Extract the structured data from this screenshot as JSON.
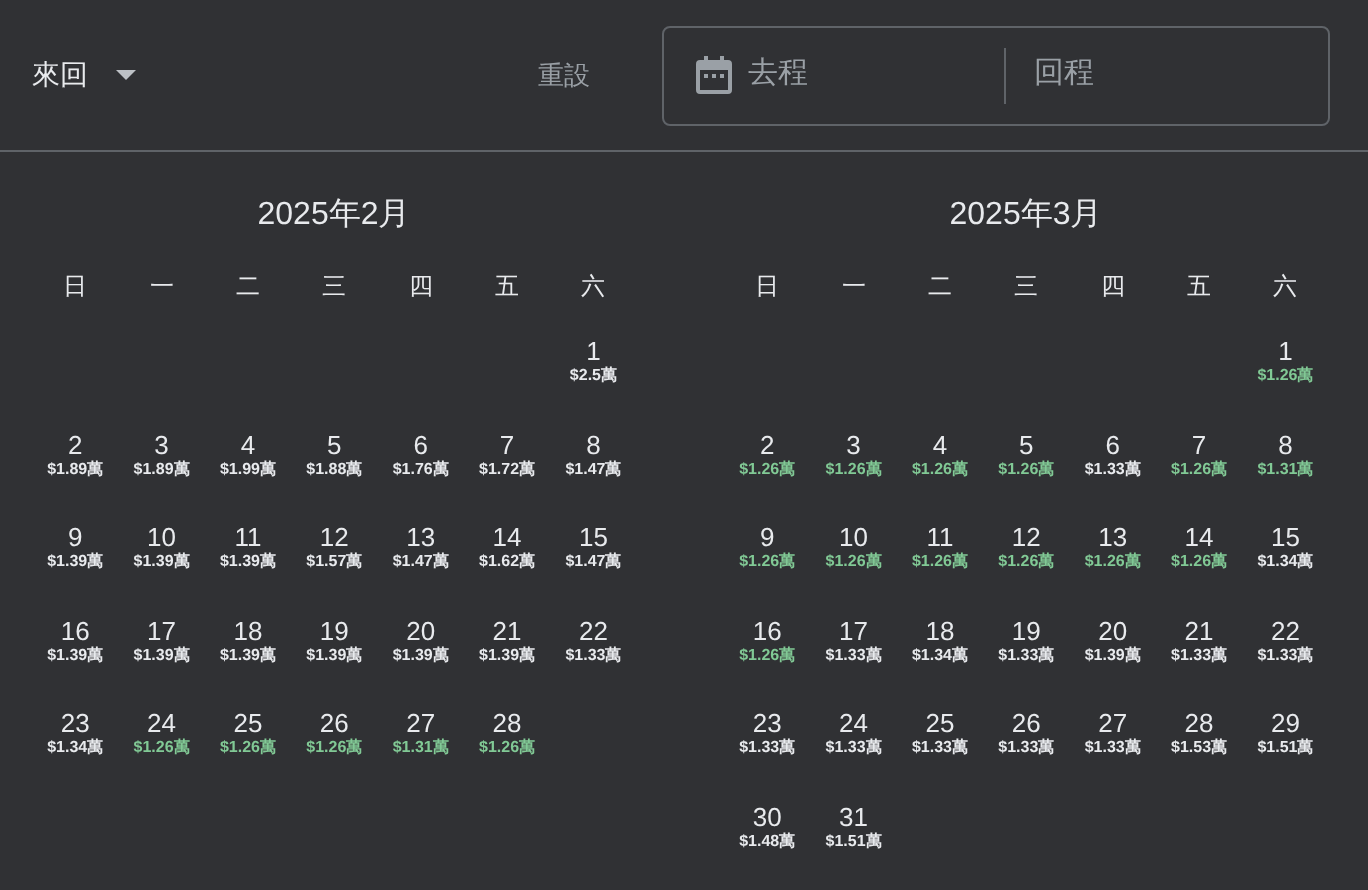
{
  "trip_type": {
    "label": "來回"
  },
  "reset_button": "重設",
  "date_field": {
    "departure_placeholder": "去程",
    "return_placeholder": "回程"
  },
  "months": [
    {
      "title": "2025年2月",
      "weekdays": [
        "日",
        "一",
        "二",
        "三",
        "四",
        "五",
        "六"
      ],
      "weeks": [
        [
          {
            "day": "1",
            "price": "$2.5萬",
            "low": false
          }
        ],
        [
          {
            "day": "2",
            "price": "$1.89萬",
            "low": false
          },
          {
            "day": "3",
            "price": "$1.89萬",
            "low": false
          },
          {
            "day": "4",
            "price": "$1.99萬",
            "low": false
          },
          {
            "day": "5",
            "price": "$1.88萬",
            "low": false
          },
          {
            "day": "6",
            "price": "$1.76萬",
            "low": false
          },
          {
            "day": "7",
            "price": "$1.72萬",
            "low": false
          },
          {
            "day": "8",
            "price": "$1.47萬",
            "low": false
          }
        ],
        [
          {
            "day": "9",
            "price": "$1.39萬",
            "low": false
          },
          {
            "day": "10",
            "price": "$1.39萬",
            "low": false
          },
          {
            "day": "11",
            "price": "$1.39萬",
            "low": false
          },
          {
            "day": "12",
            "price": "$1.57萬",
            "low": false
          },
          {
            "day": "13",
            "price": "$1.47萬",
            "low": false
          },
          {
            "day": "14",
            "price": "$1.62萬",
            "low": false
          },
          {
            "day": "15",
            "price": "$1.47萬",
            "low": false
          }
        ],
        [
          {
            "day": "16",
            "price": "$1.39萬",
            "low": false
          },
          {
            "day": "17",
            "price": "$1.39萬",
            "low": false
          },
          {
            "day": "18",
            "price": "$1.39萬",
            "low": false
          },
          {
            "day": "19",
            "price": "$1.39萬",
            "low": false
          },
          {
            "day": "20",
            "price": "$1.39萬",
            "low": false
          },
          {
            "day": "21",
            "price": "$1.39萬",
            "low": false
          },
          {
            "day": "22",
            "price": "$1.33萬",
            "low": false
          }
        ],
        [
          {
            "day": "23",
            "price": "$1.34萬",
            "low": false
          },
          {
            "day": "24",
            "price": "$1.26萬",
            "low": true
          },
          {
            "day": "25",
            "price": "$1.26萬",
            "low": true
          },
          {
            "day": "26",
            "price": "$1.26萬",
            "low": true
          },
          {
            "day": "27",
            "price": "$1.31萬",
            "low": true
          },
          {
            "day": "28",
            "price": "$1.26萬",
            "low": true
          }
        ]
      ]
    },
    {
      "title": "2025年3月",
      "weekdays": [
        "日",
        "一",
        "二",
        "三",
        "四",
        "五",
        "六"
      ],
      "weeks": [
        [
          {
            "day": "1",
            "price": "$1.26萬",
            "low": true
          }
        ],
        [
          {
            "day": "2",
            "price": "$1.26萬",
            "low": true
          },
          {
            "day": "3",
            "price": "$1.26萬",
            "low": true
          },
          {
            "day": "4",
            "price": "$1.26萬",
            "low": true
          },
          {
            "day": "5",
            "price": "$1.26萬",
            "low": true
          },
          {
            "day": "6",
            "price": "$1.33萬",
            "low": false
          },
          {
            "day": "7",
            "price": "$1.26萬",
            "low": true
          },
          {
            "day": "8",
            "price": "$1.31萬",
            "low": true
          }
        ],
        [
          {
            "day": "9",
            "price": "$1.26萬",
            "low": true
          },
          {
            "day": "10",
            "price": "$1.26萬",
            "low": true
          },
          {
            "day": "11",
            "price": "$1.26萬",
            "low": true
          },
          {
            "day": "12",
            "price": "$1.26萬",
            "low": true
          },
          {
            "day": "13",
            "price": "$1.26萬",
            "low": true
          },
          {
            "day": "14",
            "price": "$1.26萬",
            "low": true
          },
          {
            "day": "15",
            "price": "$1.34萬",
            "low": false
          }
        ],
        [
          {
            "day": "16",
            "price": "$1.26萬",
            "low": true
          },
          {
            "day": "17",
            "price": "$1.33萬",
            "low": false
          },
          {
            "day": "18",
            "price": "$1.34萬",
            "low": false
          },
          {
            "day": "19",
            "price": "$1.33萬",
            "low": false
          },
          {
            "day": "20",
            "price": "$1.39萬",
            "low": false
          },
          {
            "day": "21",
            "price": "$1.33萬",
            "low": false
          },
          {
            "day": "22",
            "price": "$1.33萬",
            "low": false
          }
        ],
        [
          {
            "day": "23",
            "price": "$1.33萬",
            "low": false
          },
          {
            "day": "24",
            "price": "$1.33萬",
            "low": false
          },
          {
            "day": "25",
            "price": "$1.33萬",
            "low": false
          },
          {
            "day": "26",
            "price": "$1.33萬",
            "low": false
          },
          {
            "day": "27",
            "price": "$1.33萬",
            "low": false
          },
          {
            "day": "28",
            "price": "$1.53萬",
            "low": false
          },
          {
            "day": "29",
            "price": "$1.51萬",
            "low": false
          }
        ],
        [
          {
            "day": "30",
            "price": "$1.48萬",
            "low": false
          },
          {
            "day": "31",
            "price": "$1.51萬",
            "low": false
          }
        ]
      ]
    }
  ]
}
